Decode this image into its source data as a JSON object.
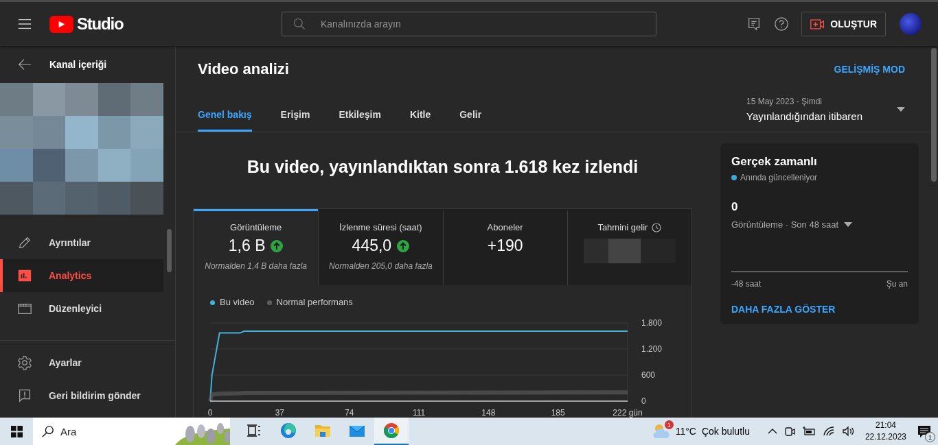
{
  "topbar": {
    "logo_text": "Studio",
    "search": {
      "placeholder": "Kanalınızda arayın"
    },
    "create_button": "OLUŞTUR"
  },
  "sidebar": {
    "back_label": "Kanal içeriği",
    "items": [
      {
        "kind": "pencil",
        "label": "Ayrıntılar",
        "selected": false
      },
      {
        "kind": "analytics",
        "label": "Analytics",
        "selected": true
      },
      {
        "kind": "clapper",
        "label": "Düzenleyici",
        "selected": false
      }
    ],
    "footer_items": [
      {
        "kind": "gear",
        "label": "Ayarlar"
      },
      {
        "kind": "feedback",
        "label": "Geri bildirim gönder"
      }
    ]
  },
  "page": {
    "title": "Video analizi",
    "advanced_mode": "GELİŞMİŞ MOD",
    "tabs": [
      {
        "label": "Genel bakış",
        "selected": true
      },
      {
        "label": "Erişim",
        "selected": false
      },
      {
        "label": "Etkileşim",
        "selected": false
      },
      {
        "label": "Kitle",
        "selected": false
      },
      {
        "label": "Gelir",
        "selected": false
      }
    ],
    "date_range": {
      "range": "15 May 2023 - Şimdi",
      "label": "Yayınlandığından itibaren"
    }
  },
  "overview": {
    "headline": "Bu video, yayınlandıktan sonra 1.618 kez izlendi",
    "metrics": [
      {
        "kind": "number",
        "label": "Görüntüleme",
        "value": "1,6 B",
        "trend_up": true,
        "note": "Normalden 1,4 B daha fazla",
        "selected": true
      },
      {
        "kind": "number",
        "label": "İzlenme süresi (saat)",
        "value": "445,0",
        "trend_up": true,
        "note": "Normalden 205,0 daha fazla",
        "selected": false
      },
      {
        "kind": "number",
        "label": "Aboneler",
        "value": "+190",
        "selected": false
      },
      {
        "kind": "hidden",
        "label": "Tahmini gelir",
        "selected": false
      }
    ],
    "chart_data": {
      "type": "line",
      "x": [
        0,
        1,
        5,
        16,
        18,
        222
      ],
      "series": [
        {
          "name": "Bu video",
          "color": "#41b4d8",
          "values": [
            0,
            600,
            1570,
            1570,
            1610,
            1610
          ]
        },
        {
          "name": "Normal performans",
          "color": "#5f5f5f",
          "values": [
            0,
            150,
            170,
            180,
            190,
            200
          ]
        }
      ],
      "xlim": [
        0,
        222
      ],
      "ylim": [
        0,
        1800
      ],
      "xticks": [
        0,
        37,
        74,
        111,
        148,
        185,
        {
          "value": 222,
          "label": "222 gün"
        }
      ],
      "yticks": [
        0,
        600,
        {
          "value": 1200,
          "label": "1.200"
        },
        {
          "value": 1800,
          "label": "1.800"
        }
      ]
    }
  },
  "realtime": {
    "title": "Gerçek zamanlı",
    "status": "Anında güncelleniyor",
    "value": "0",
    "metric": "Görüntüleme · Son 48 saat",
    "axis_start": "-48 saat",
    "axis_end": "Şu an",
    "more_link": "DAHA FAZLA GÖSTER"
  },
  "taskbar": {
    "search": {
      "placeholder": "Ara"
    },
    "apps": [
      {
        "kind": "task-view",
        "active": false
      },
      {
        "kind": "edge",
        "active": false
      },
      {
        "kind": "explorer",
        "active": false
      },
      {
        "kind": "mail",
        "active": false
      },
      {
        "kind": "chrome",
        "active": true
      }
    ],
    "weather": {
      "badge": "1",
      "temperature": "11°C",
      "condition": "Çok bulutlu"
    },
    "clock": {
      "time": "21:04",
      "date": "22.12.2023"
    },
    "notifications": {
      "badge": "1"
    }
  }
}
